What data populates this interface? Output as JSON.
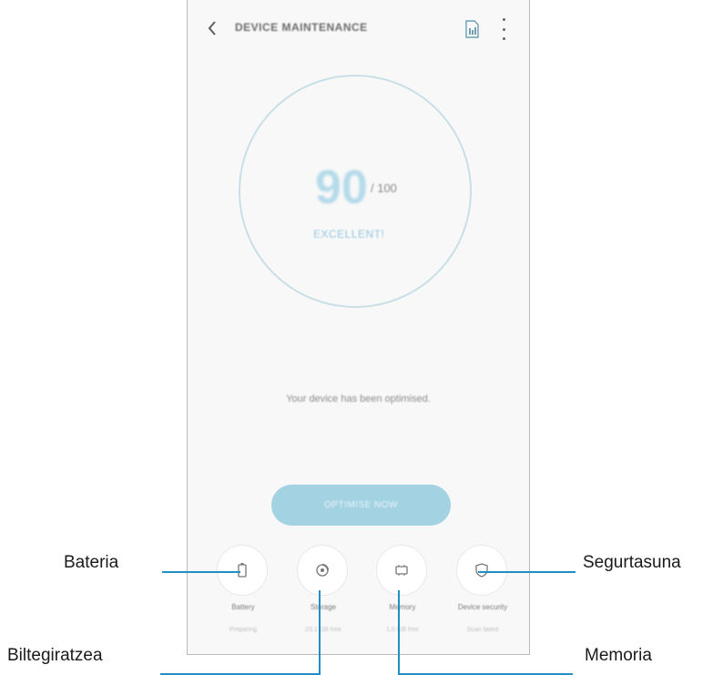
{
  "header": {
    "title": "DEVICE MAINTENANCE"
  },
  "score": {
    "value": "90",
    "max": "/ 100",
    "status": "EXCELLENT!"
  },
  "message": "Your device has been optimised.",
  "optimize_button": "OPTIMISE NOW",
  "items": [
    {
      "label": "Battery",
      "sub": "Preparing"
    },
    {
      "label": "Storage",
      "sub": "23.1 GB free"
    },
    {
      "label": "Memory",
      "sub": "1.0 GB free"
    },
    {
      "label": "Device security",
      "sub": "Scan failed"
    }
  ],
  "callouts": {
    "battery": "Bateria",
    "storage": "Biltegiratzea",
    "memory": "Memoria",
    "security": "Segurtasuna"
  },
  "colors": {
    "accent": "#a3d2e2",
    "gauge_ring": "#c9dfe7",
    "callout_line": "#1f8fc6"
  }
}
